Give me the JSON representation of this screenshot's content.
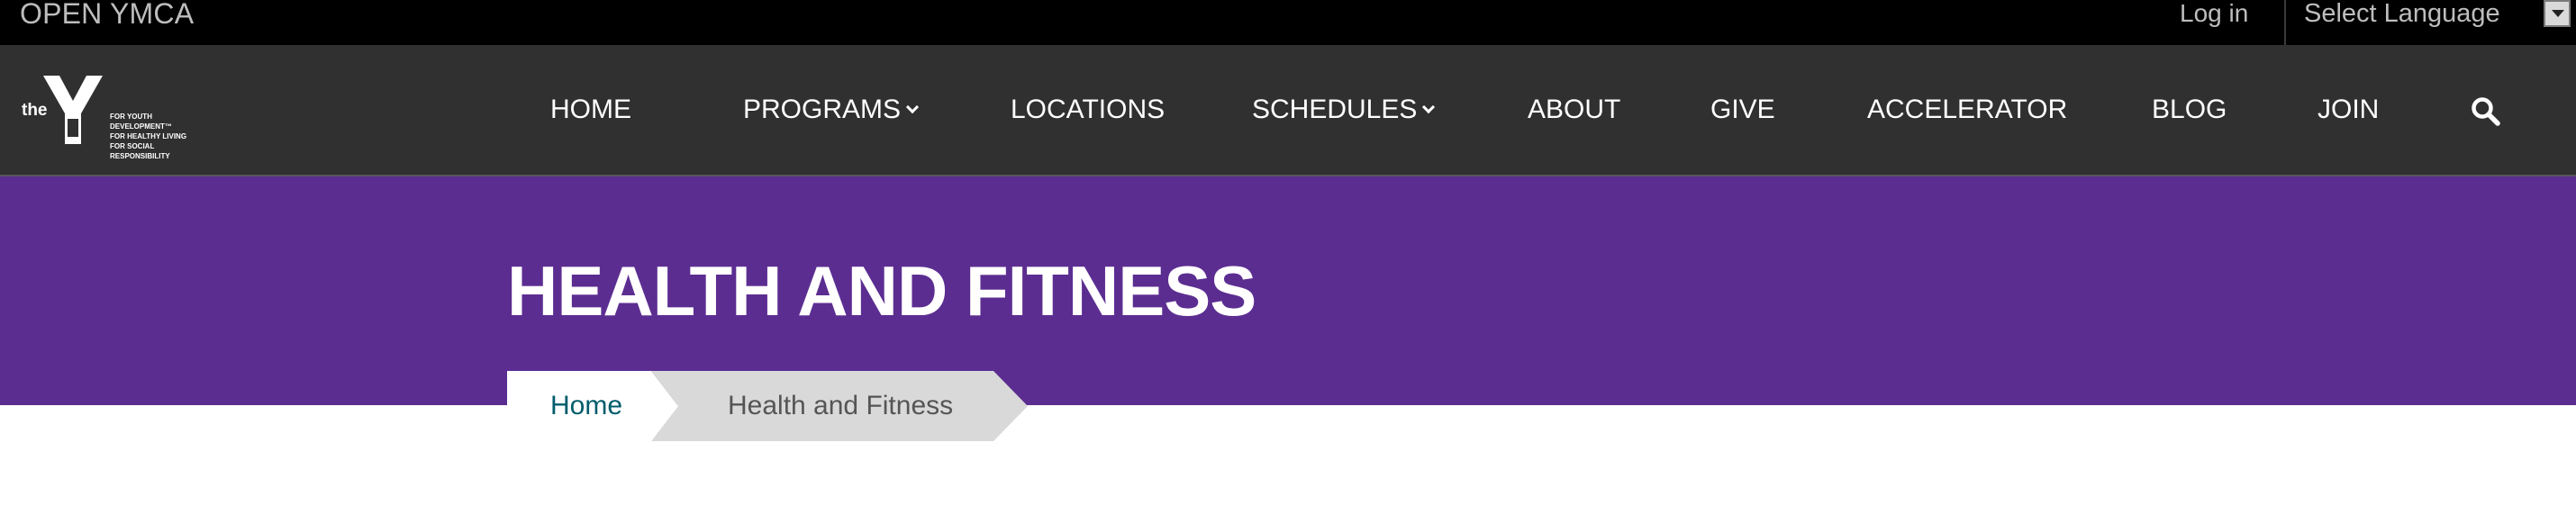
{
  "topbar": {
    "brand": "OPEN YMCA",
    "login": "Log in",
    "language_select": "Select Language"
  },
  "logo": {
    "prefix": "the",
    "tagline": "FOR YOUTH DEVELOPMENT™\nFOR HEALTHY LIVING\nFOR SOCIAL RESPONSIBILITY"
  },
  "nav": {
    "items": [
      {
        "label": "HOME",
        "has_dropdown": false
      },
      {
        "label": "PROGRAMS",
        "has_dropdown": true
      },
      {
        "label": "LOCATIONS",
        "has_dropdown": false
      },
      {
        "label": "SCHEDULES",
        "has_dropdown": true
      },
      {
        "label": "ABOUT",
        "has_dropdown": false
      },
      {
        "label": "GIVE",
        "has_dropdown": false
      },
      {
        "label": "ACCELERATOR",
        "has_dropdown": false
      },
      {
        "label": "BLOG",
        "has_dropdown": false
      },
      {
        "label": "JOIN",
        "has_dropdown": false
      }
    ],
    "search_icon": "search-icon"
  },
  "hero": {
    "title": "HEALTH AND FITNESS"
  },
  "breadcrumb": {
    "home": "Home",
    "current": "Health and Fitness"
  },
  "colors": {
    "topbar_bg": "#000000",
    "navbar_bg": "#303030",
    "hero_purple": "#5c2d91",
    "breadcrumb_link": "#005c6b",
    "breadcrumb_current_bg": "#d9d9d9"
  }
}
